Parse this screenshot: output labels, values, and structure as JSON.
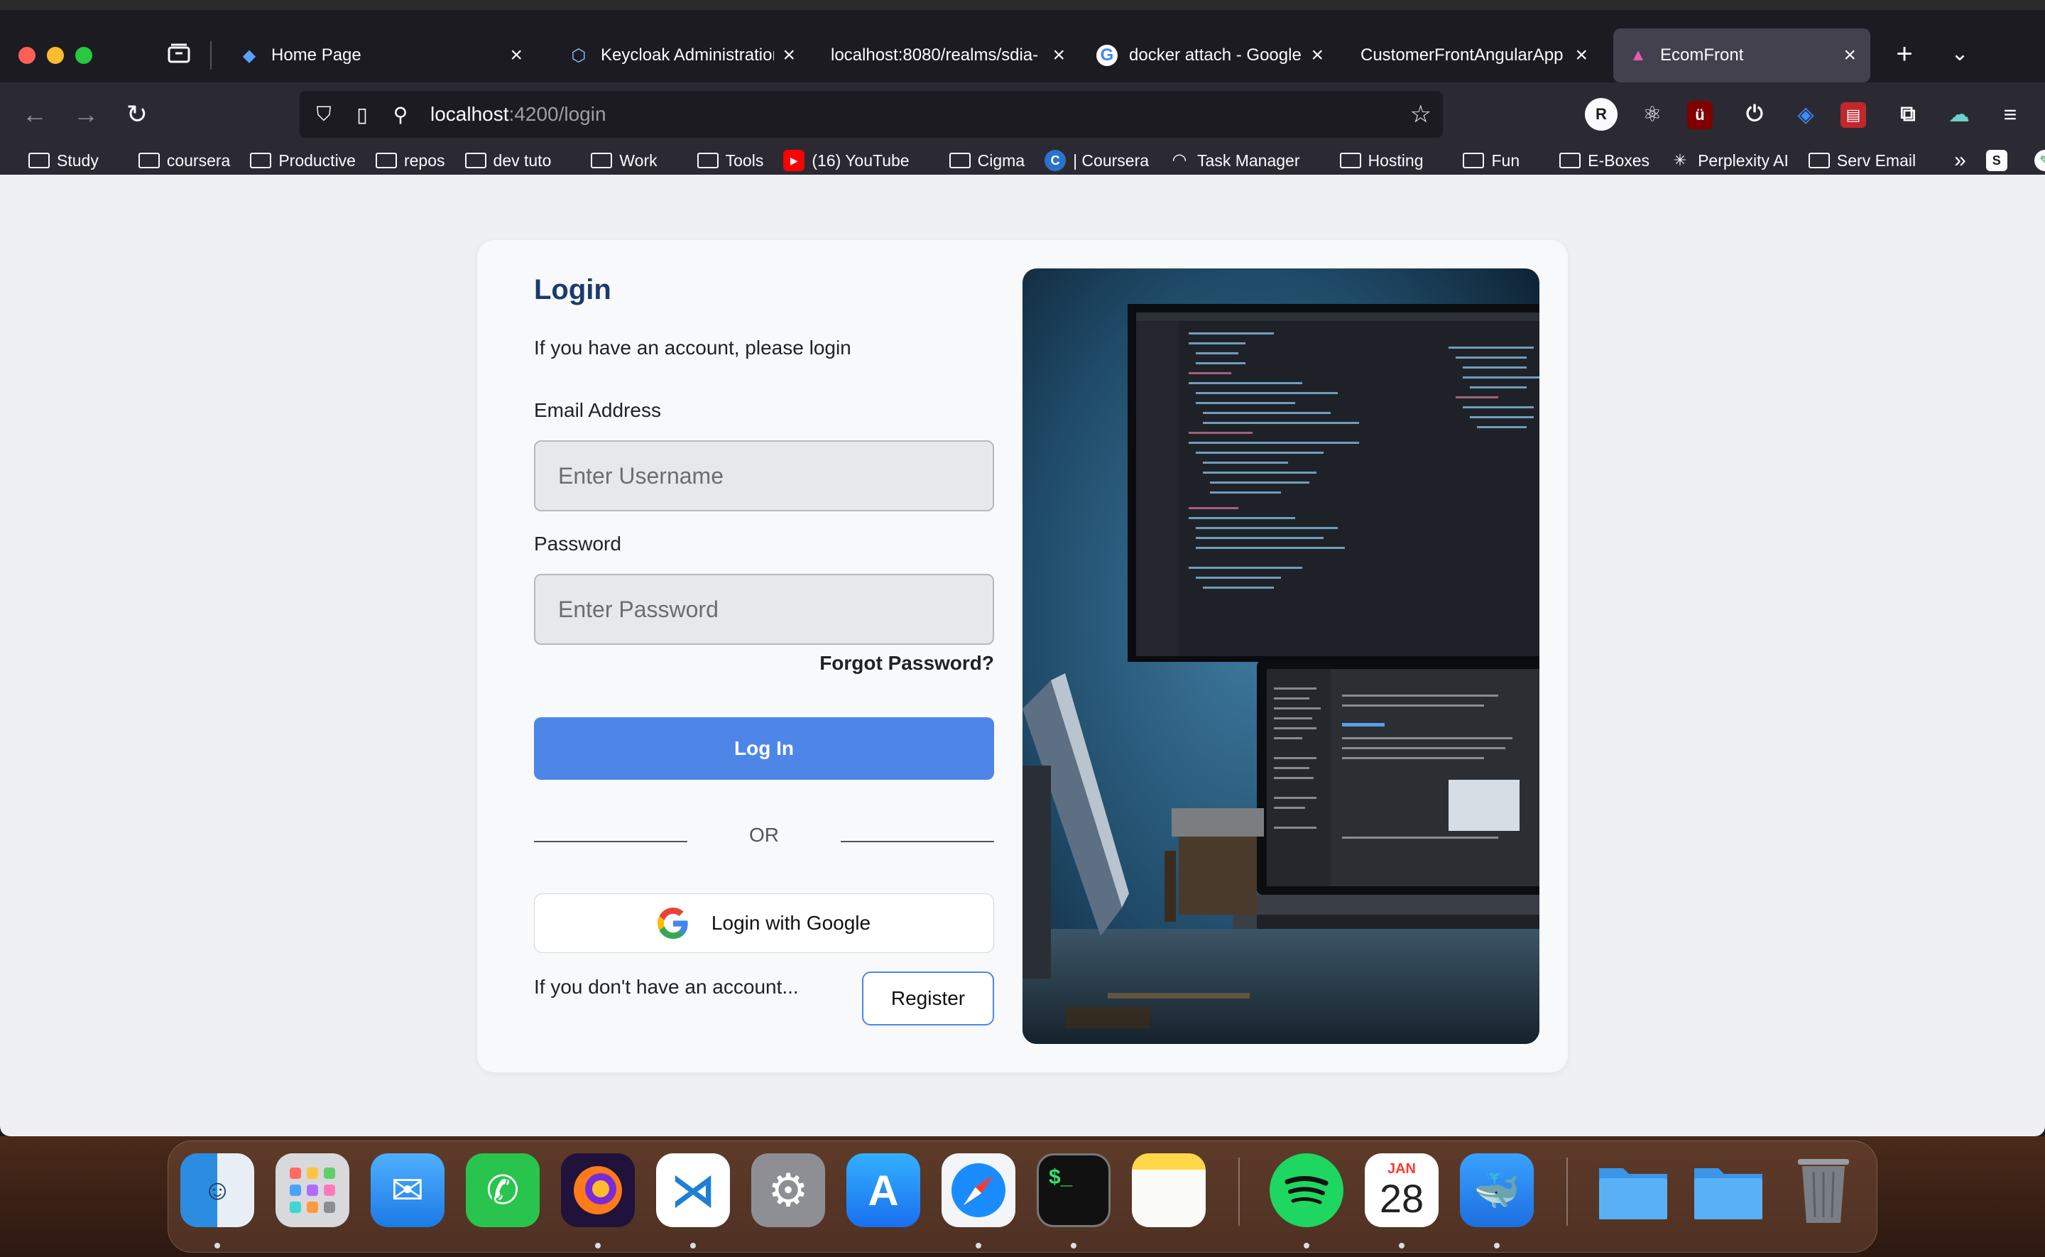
{
  "browser": {
    "tabs": [
      {
        "label": "Home Page",
        "favicon": "gem-icon"
      },
      {
        "label": "Keycloak Administration",
        "favicon": "keycloak-icon"
      },
      {
        "label": "localhost:8080/realms/sdia-",
        "favicon": ""
      },
      {
        "label": "docker attach - Google S",
        "favicon": "google-icon"
      },
      {
        "label": "CustomerFrontAngularApp",
        "favicon": ""
      },
      {
        "label": "EcomFront",
        "favicon": "angular-icon",
        "active": true
      }
    ],
    "url_host": "localhost",
    "url_path": ":4200/login",
    "bookmarks": [
      "Study",
      "coursera",
      "Productive",
      "repos",
      "dev tuto",
      "Work",
      "Tools",
      "(16) YouTube",
      "Cigma",
      "| Coursera",
      "Task Manager",
      "Hosting",
      "Fun",
      "E-Boxes",
      "Perplexity AI",
      "Serv Email"
    ],
    "extensions": [
      "R",
      "react-icon",
      "uBlock-icon",
      "power-icon",
      "diamond-icon",
      "pdf-icon",
      "puzzle-icon",
      "cloud-icon"
    ]
  },
  "login": {
    "title": "Login",
    "subtitle": "If you have an account, please login",
    "email_label": "Email Address",
    "email_placeholder": "Enter Username",
    "password_label": "Password",
    "password_placeholder": "Enter Password",
    "forgot": "Forgot Password?",
    "login_button": "Log In",
    "or": "OR",
    "google_button": "Login with Google",
    "no_account": "If you don't have an account...",
    "register_button": "Register"
  },
  "dock": {
    "calendar_month": "JAN",
    "calendar_day": "28",
    "apps": [
      "finder",
      "launchpad",
      "mail",
      "whatsapp",
      "firefox",
      "vscode",
      "system-settings",
      "app-store",
      "safari",
      "terminal",
      "notes",
      "spotify",
      "calendar",
      "docker",
      "downloads-folder",
      "documents-folder",
      "trash"
    ]
  },
  "colors": {
    "primary": "#4e86e8",
    "title": "#1c3a6e",
    "page_bg": "#eef0f3"
  }
}
